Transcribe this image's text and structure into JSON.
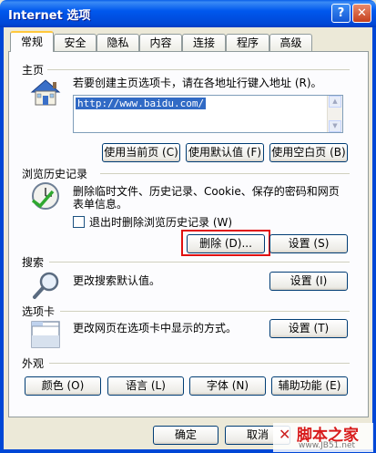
{
  "window": {
    "title": "Internet 选项",
    "help_glyph": "?",
    "close_glyph": "✕"
  },
  "tabs": [
    {
      "label": "常规",
      "active": true
    },
    {
      "label": "安全"
    },
    {
      "label": "隐私"
    },
    {
      "label": "内容"
    },
    {
      "label": "连接"
    },
    {
      "label": "程序"
    },
    {
      "label": "高级"
    }
  ],
  "home": {
    "title": "主页",
    "description": "若要创建主页选项卡，请在各地址行键入地址 (R)。",
    "url": "http://www.baidu.com/",
    "buttons": {
      "current": "使用当前页 (C)",
      "default": "使用默认值 (F)",
      "blank": "使用空白页 (B)"
    }
  },
  "history": {
    "title": "浏览历史记录",
    "description_line1": "删除临时文件、历史记录、Cookie、保存的密码和网页",
    "description_line2": "表单信息。",
    "checkbox_label": "退出时删除浏览历史记录 (W)",
    "checkbox_checked": false,
    "buttons": {
      "delete": "删除 (D)...",
      "settings": "设置 (S)"
    }
  },
  "search": {
    "title": "搜索",
    "description": "更改搜索默认值。",
    "settings": "设置 (I)"
  },
  "tabsection": {
    "title": "选项卡",
    "description": "更改网页在选项卡中显示的方式。",
    "settings": "设置 (T)"
  },
  "appearance": {
    "title": "外观",
    "buttons": {
      "colors": "颜色 (O)",
      "languages": "语言 (L)",
      "fonts": "字体 (N)",
      "accessibility": "辅助功能 (E)"
    }
  },
  "footer": {
    "ok": "确定",
    "cancel": "取消"
  },
  "watermark": {
    "text": "脚本之家",
    "url": "www.JB51.net"
  }
}
